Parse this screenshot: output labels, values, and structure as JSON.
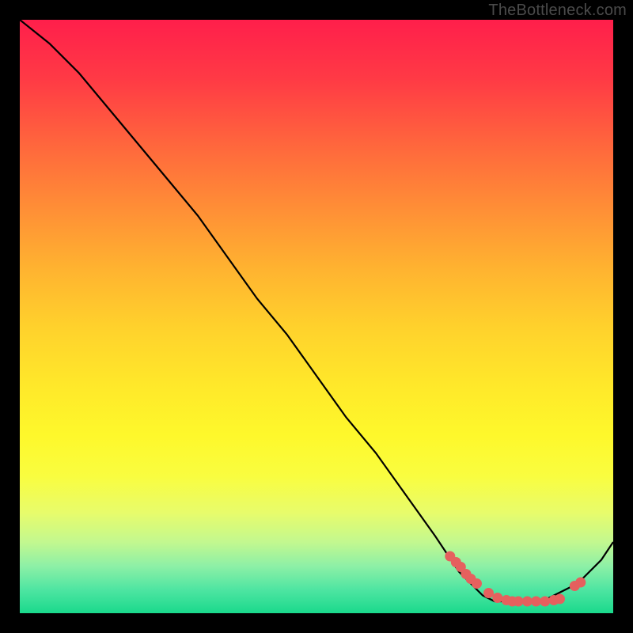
{
  "watermark": "TheBottleneck.com",
  "chart_data": {
    "type": "line",
    "title": "",
    "xlabel": "",
    "ylabel": "",
    "xlim": [
      0,
      100
    ],
    "ylim": [
      0,
      100
    ],
    "note": "Axes are unlabeled in the image; values below are positional estimates (0–100) read from the plot area.",
    "series": [
      {
        "name": "curve",
        "x": [
          0,
          5,
          10,
          15,
          20,
          25,
          30,
          35,
          40,
          45,
          50,
          55,
          60,
          65,
          70,
          72,
          74,
          76,
          78,
          80,
          82,
          84,
          86,
          88,
          90,
          92,
          94,
          96,
          98,
          100
        ],
        "y": [
          100,
          96,
          91,
          85,
          79,
          73,
          67,
          60,
          53,
          47,
          40,
          33,
          27,
          20,
          13,
          10,
          7,
          5,
          3,
          2,
          2,
          2,
          2,
          2,
          3,
          4,
          5,
          7,
          9,
          12
        ]
      }
    ],
    "markers": {
      "name": "highlighted-points",
      "color": "#e5605e",
      "x": [
        72.5,
        73.5,
        74.3,
        75.2,
        76.0,
        77.0,
        79.0,
        80.5,
        82.0,
        83.0,
        84.0,
        85.5,
        87.0,
        88.5,
        90.0,
        91.0,
        93.5,
        94.5
      ],
      "y": [
        9.6,
        8.6,
        7.8,
        6.6,
        5.8,
        5.0,
        3.4,
        2.6,
        2.2,
        2.0,
        2.0,
        2.0,
        2.0,
        2.0,
        2.2,
        2.4,
        4.6,
        5.2
      ]
    },
    "background_gradient": {
      "direction": "top-to-bottom",
      "stops": [
        {
          "pos": 0.0,
          "color": "#ff1f4b"
        },
        {
          "pos": 0.5,
          "color": "#ffd22c"
        },
        {
          "pos": 0.82,
          "color": "#e8fc6b"
        },
        {
          "pos": 1.0,
          "color": "#1ad98c"
        }
      ]
    }
  }
}
